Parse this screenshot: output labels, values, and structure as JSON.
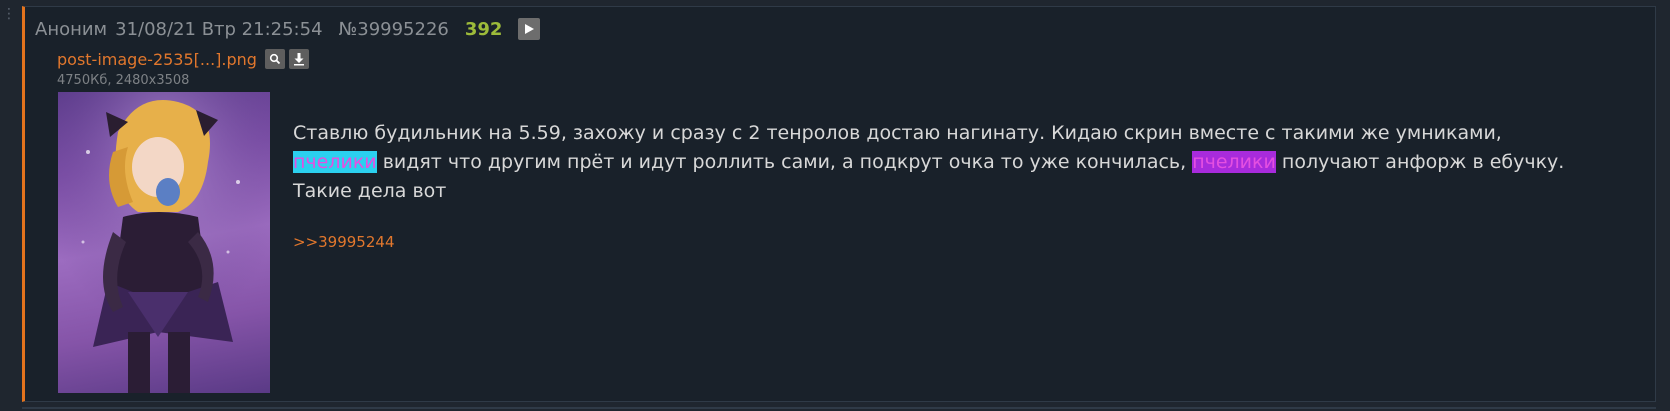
{
  "colors": {
    "page_bg": "#1f262f",
    "post_bg": "#19212a",
    "accent_border": "#e3731d",
    "meta_text": "#8b9095",
    "reply_count": "#9dbb3a",
    "link": "#e1772d",
    "body_text": "#d8d8d8",
    "spoiler_cyan_bg": "#2bd0ef",
    "spoiler_purple_bg": "#a82bdc",
    "spoiler_text": "#e44fe1"
  },
  "post": {
    "author": "Аноним",
    "date": "31/08/21 Втр 21:25:54",
    "number": "№39995226",
    "reply_count": "392",
    "expand_icon": "play-icon",
    "file": {
      "name": "post-image-2535[...].png",
      "search_icon": "search-icon",
      "download_icon": "download-icon",
      "meta": "4750Кб, 2480x3508"
    },
    "body": {
      "line1": "Ставлю будильник на 5.59, захожу и сразу с 2 тенролов достаю нагинату. Кидаю скрин вместе с такими же умниками,",
      "word1": "пчелики",
      "mid2": " видят что другим прёт и идут роллить сами, а подкрут очка то уже кончилась, ",
      "word2": "пчелики",
      "end2": " получают анфорж в ебучку.",
      "line3": "Такие дела вот"
    },
    "reply_link": ">>39995244"
  }
}
